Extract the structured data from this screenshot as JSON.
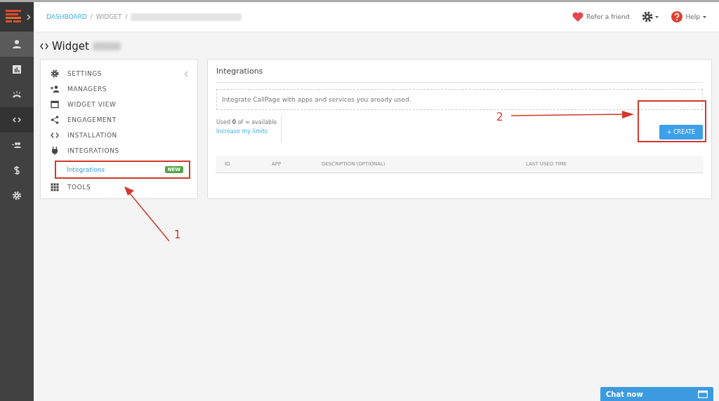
{
  "breadcrumb": [
    {
      "label": "DASHBOARD",
      "separator": "/",
      "selected": false
    },
    {
      "label": "WIDGET",
      "separator": "/",
      "selected": true
    }
  ],
  "header": {
    "refer": "Refer a friend",
    "help": "Help"
  },
  "rail": [
    {
      "kind": "user",
      "selected": false
    },
    {
      "kind": "chart",
      "selected": false
    },
    {
      "kind": "phone",
      "selected": false
    },
    {
      "kind": "code",
      "selected": true
    },
    {
      "kind": "users",
      "selected": false
    },
    {
      "kind": "dollar",
      "selected": false
    },
    {
      "kind": "gear",
      "selected": false
    }
  ],
  "page_title": "Widget",
  "menu": [
    {
      "kind": "gear",
      "label": "SETTINGS"
    },
    {
      "kind": "person-add",
      "label": "MANAGERS"
    },
    {
      "kind": "window",
      "label": "WIDGET VIEW"
    },
    {
      "kind": "share",
      "label": "ENGAGEMENT"
    },
    {
      "kind": "code",
      "label": "INSTALLATION"
    },
    {
      "kind": "plug",
      "label": "INTEGRATIONS",
      "children": [
        {
          "label": "Integrations",
          "badge": "NEW",
          "selected": true
        }
      ]
    },
    {
      "kind": "grid",
      "label": "TOOLS"
    }
  ],
  "panel": {
    "title": "Integrations",
    "info": "Integrate CallPage with apps and services you aready used.",
    "usage": "Used **0** of ∞ available",
    "limits_link": "Increase my limits",
    "create_button": "+ CREATE",
    "columns": [
      "ID",
      "APP",
      "DESCRIPTION (OPTIONAL)",
      "LAST USED TIME"
    ]
  },
  "annotations": [
    {
      "label": "1"
    },
    {
      "label": "2"
    }
  ],
  "chat_button": "Chat now"
}
